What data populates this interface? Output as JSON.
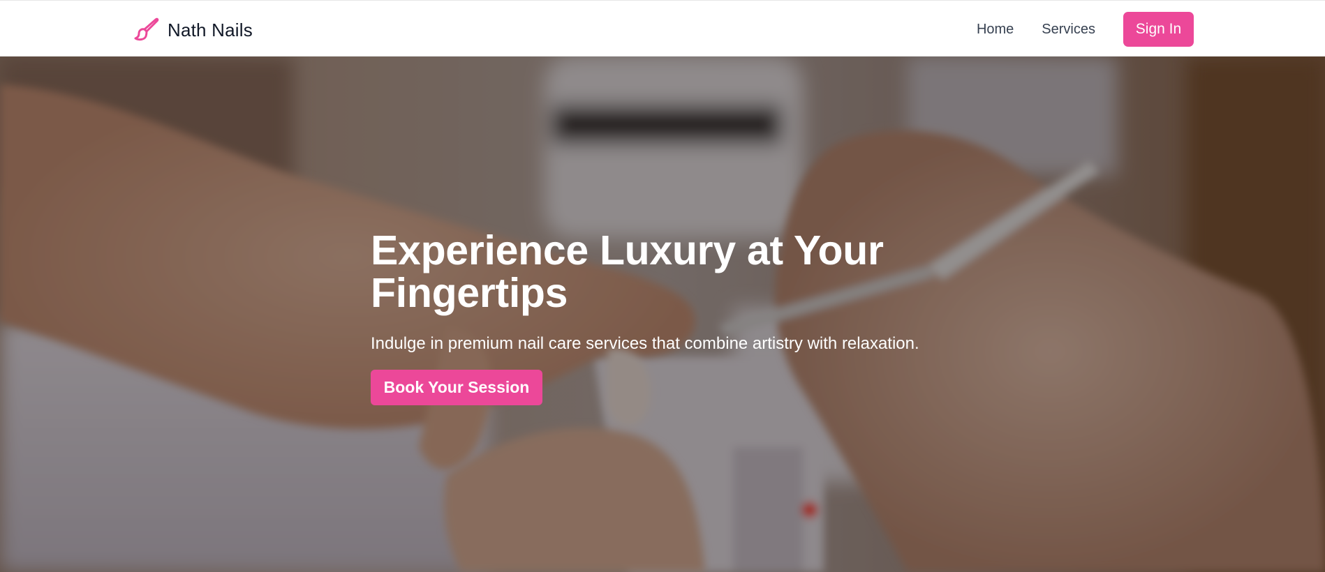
{
  "header": {
    "brand_name": "Nath Nails",
    "brand_icon": "paintbrush-icon",
    "nav_links": [
      "Home",
      "Services"
    ],
    "sign_in_label": "Sign In"
  },
  "hero": {
    "background_image": "nail-salon-manicure-photo",
    "title": "Experience Luxury at Your Fingertips",
    "subtitle": "Indulge in premium nail care services that combine artistry with relaxation.",
    "cta_label": "Book Your Session"
  },
  "colors": {
    "accent": "#ec4899",
    "brand_text": "#111827",
    "nav_text": "#374151",
    "hero_text": "#ffffff"
  }
}
